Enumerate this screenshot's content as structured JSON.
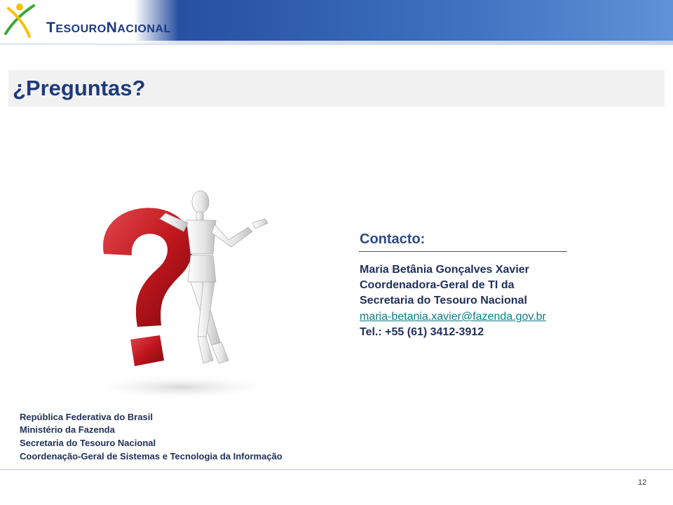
{
  "header": {
    "brand_prefix": "T",
    "brand_rest1": "ESOURO",
    "brand_mid": "N",
    "brand_rest2": "ACIONAL"
  },
  "slide": {
    "title": "¿Preguntas?"
  },
  "contact": {
    "title": "Contacto:",
    "name": "Maria Betânia Gonçalves Xavier",
    "role": "Coordenadora-Geral de TI da",
    "org": "Secretaria do Tesouro Nacional",
    "email": "maria-betania.xavier@fazenda.gov.br",
    "phone": "Tel.: +55 (61) 3412-3912"
  },
  "footer": {
    "lines": [
      "República Federativa do Brasil",
      "Ministério da Fazenda",
      "Secretaria do Tesouro Nacional",
      "Coordenação-Geral de Sistemas e Tecnologia da Informação"
    ],
    "page_number": "12"
  },
  "colors": {
    "header_blue": "#2b56a8",
    "logo_green": "#3aa935",
    "logo_yellow": "#f4c200",
    "question_red": "#c0161d",
    "link_teal": "#0b7c87"
  }
}
